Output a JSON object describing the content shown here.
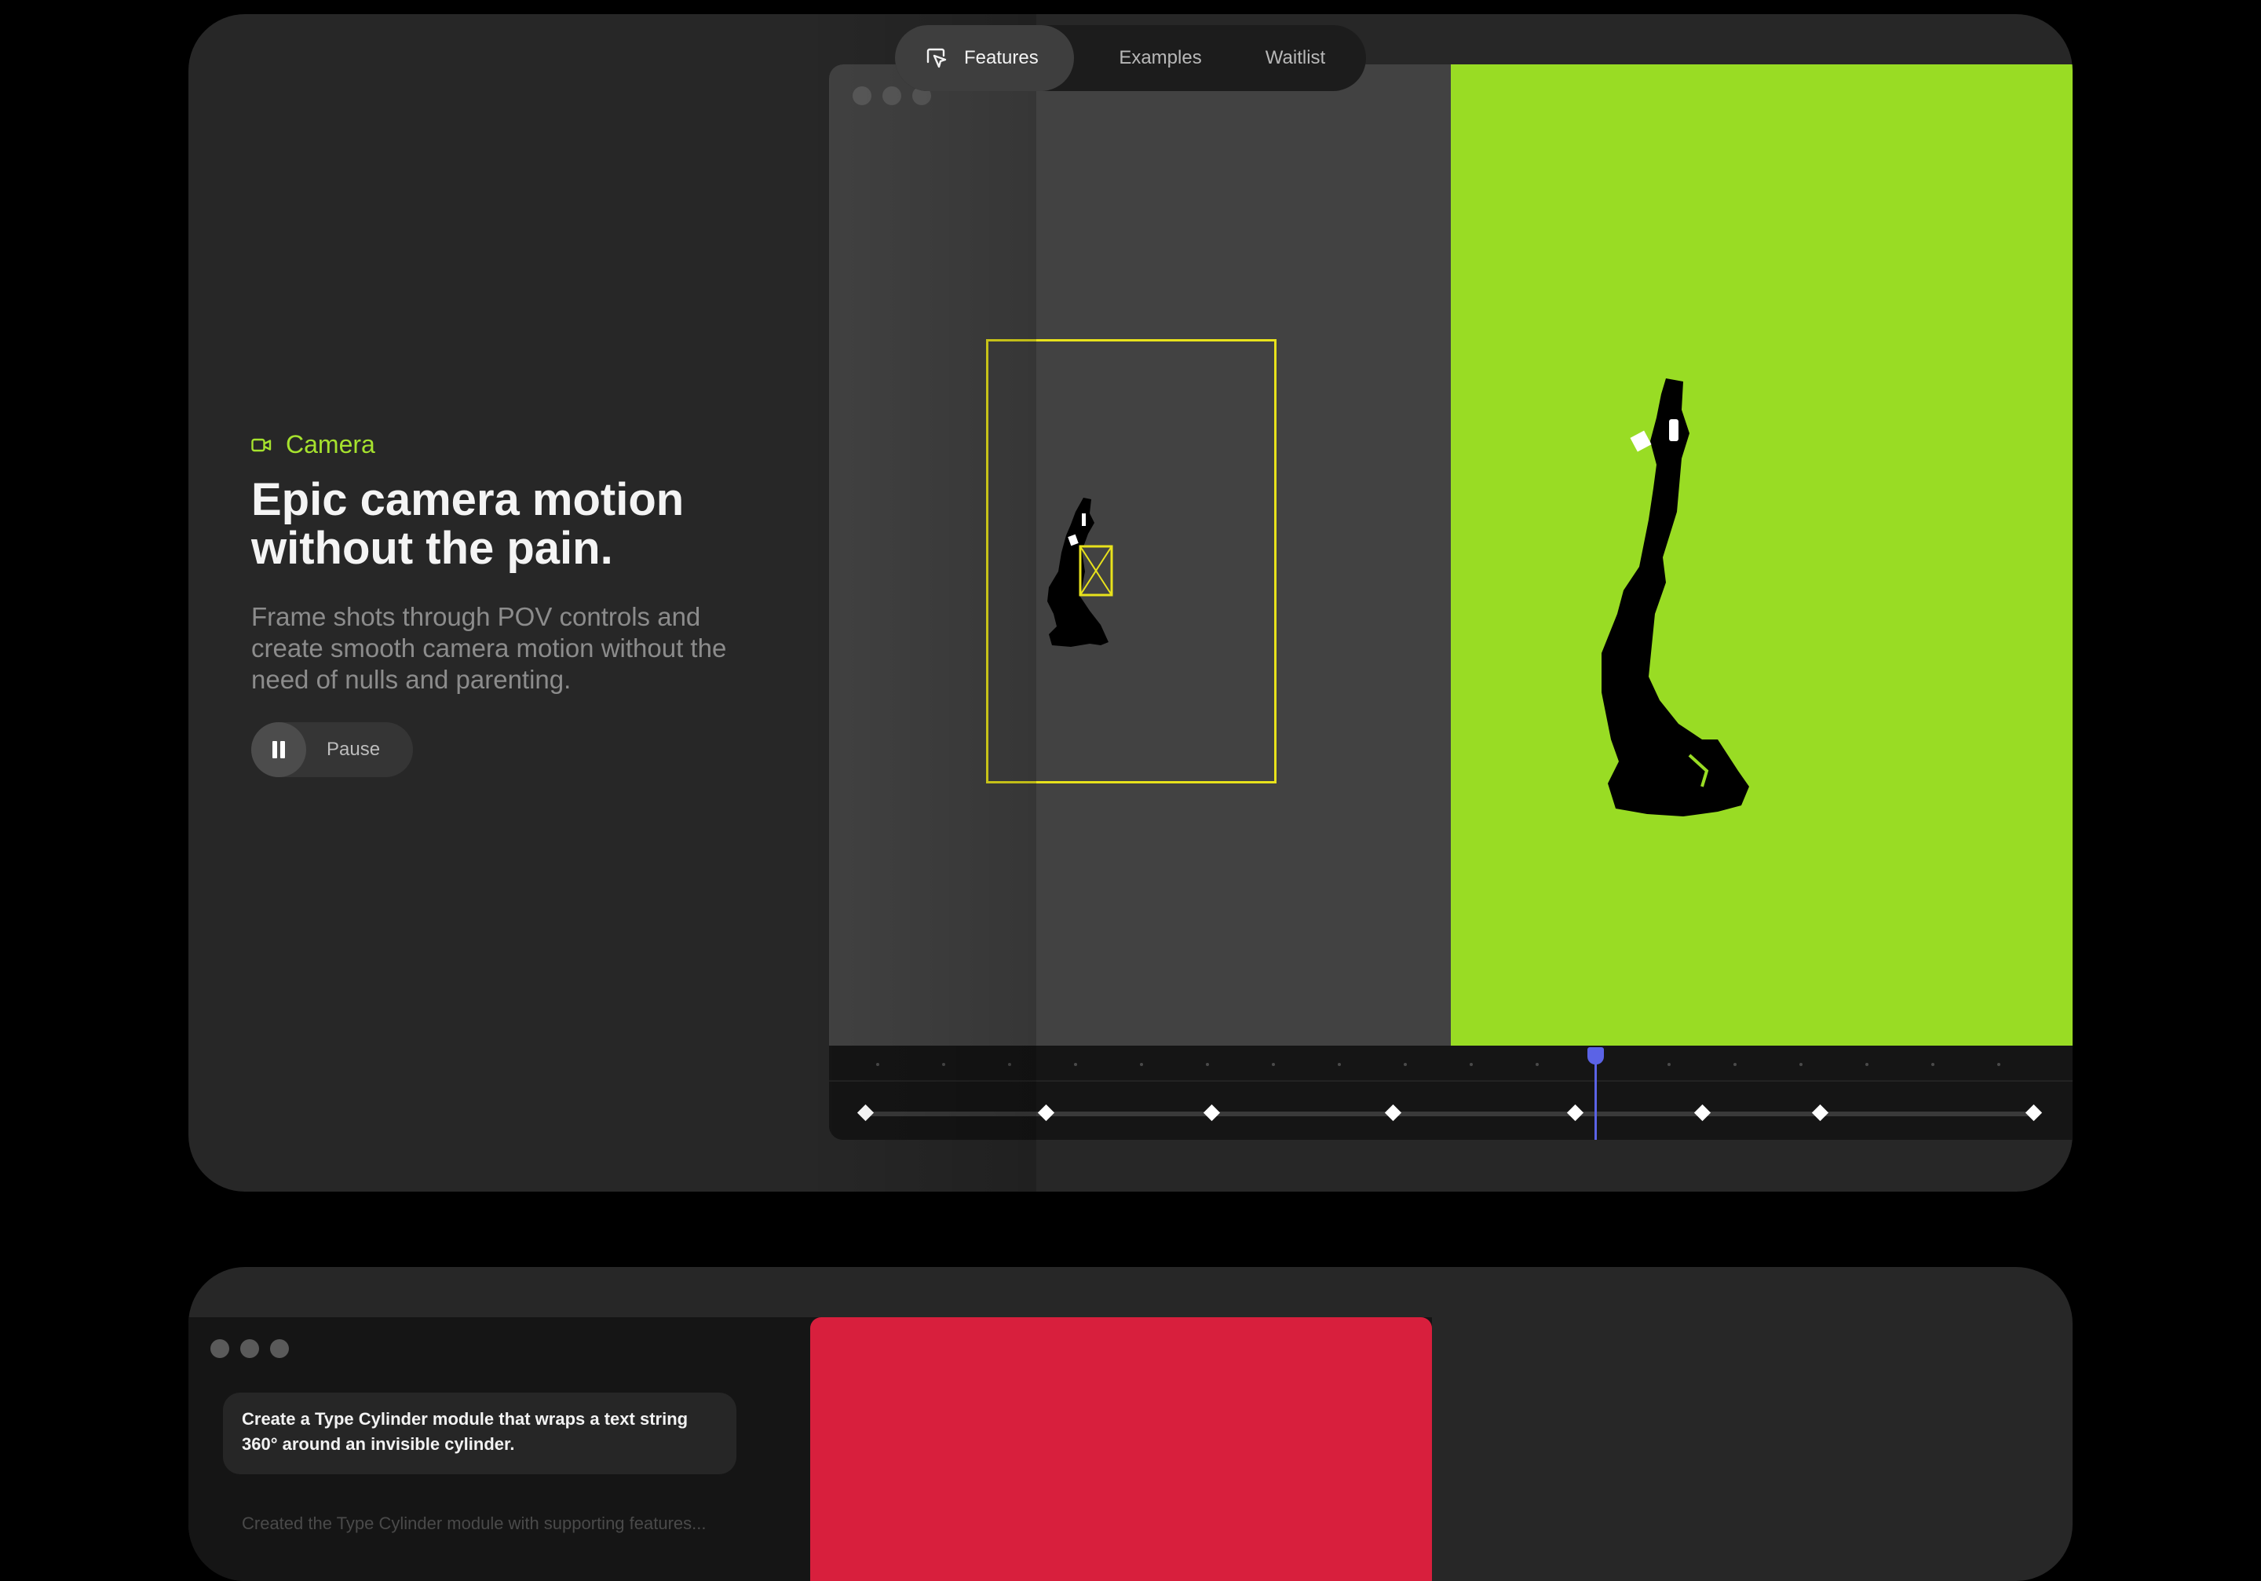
{
  "nav": {
    "items": [
      {
        "label": "Features",
        "icon": "cursor-select-icon",
        "active": true
      },
      {
        "label": "Examples"
      },
      {
        "label": "Waitlist"
      }
    ]
  },
  "feature": {
    "eyebrow": "Camera",
    "eyebrow_icon": "video-camera-icon",
    "headline": "Epic camera motion without the pain.",
    "body": "Frame shots through POV controls and create smooth camera motion without the need of nulls and parenting.",
    "pause_label": "Pause"
  },
  "timeline": {
    "playhead_position": 0.61,
    "keyframe_count": 8
  },
  "second_card": {
    "prompt": "Create a Type Cylinder module that wraps a text string 360° around an invisible cylinder.",
    "partial_text": "Created the Type Cylinder module with supporting features..."
  },
  "colors": {
    "accent": "#a6e22e",
    "viewport_green": "#99dc24",
    "frame_yellow": "#e8e21c",
    "playhead": "#5b63e6",
    "red_panel": "#d81f3d"
  }
}
